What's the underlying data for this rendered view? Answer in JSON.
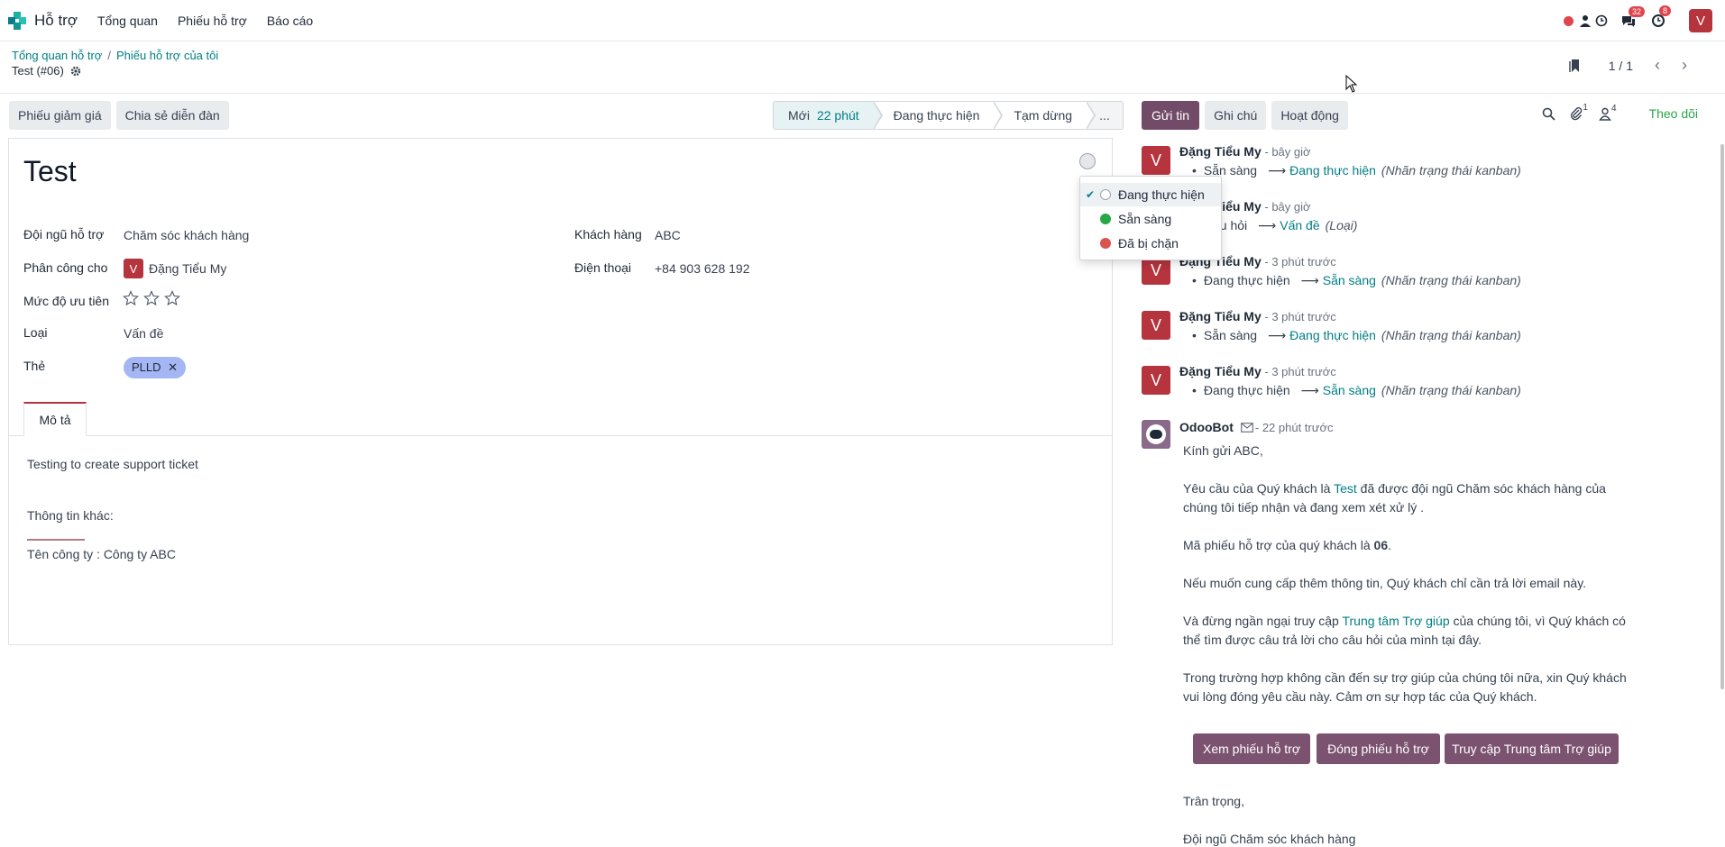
{
  "navbar": {
    "app_name": "Hỗ trợ",
    "menu": [
      "Tổng quan",
      "Phiếu hỗ trợ",
      "Báo cáo"
    ],
    "messages_count": "32",
    "activities_count": "8",
    "user_initial": "V"
  },
  "breadcrumb": {
    "items": [
      "Tổng quan hỗ trợ",
      "Phiếu hỗ trợ của tôi"
    ],
    "current": "Test (#06)"
  },
  "pager": {
    "value": "1 / 1"
  },
  "actions": {
    "coupon": "Phiếu giảm giá",
    "share_forum": "Chia sẻ diễn đàn"
  },
  "stages": [
    {
      "label": "Mới",
      "duration": "22 phút"
    },
    {
      "label": "Đang thực hiện"
    },
    {
      "label": "Tạm dừng"
    },
    {
      "label": "..."
    }
  ],
  "form": {
    "title": "Test",
    "team_label": "Đội ngũ hỗ trợ",
    "team_value": "Chăm sóc khách hàng",
    "assign_label": "Phân công cho",
    "assign_initial": "V",
    "assign_value": "Đặng Tiểu My",
    "priority_label": "Mức độ ưu tiên",
    "type_label": "Loại",
    "type_value": "Vấn đề",
    "tags_label": "Thẻ",
    "tag_value": "PLLD",
    "customer_label": "Khách hàng",
    "customer_value": "ABC",
    "phone_label": "Điện thoại",
    "phone_value": "+84 903 628 192",
    "tab_description": "Mô tả",
    "desc_line1": "Testing to create support ticket",
    "desc_line2": "Thông tin khác:",
    "desc_line3": "Tên công ty : Công ty ABC"
  },
  "kanban_dropdown": {
    "items": [
      {
        "label": "Đang thực hiện",
        "color": "#ffffff"
      },
      {
        "label": "Sẵn sàng",
        "color": "#28a745"
      },
      {
        "label": "Đã bị chặn",
        "color": "#d9534f"
      }
    ]
  },
  "chatter": {
    "send_message": "Gửi tin",
    "log_note": "Ghi chú",
    "activities": "Hoạt động",
    "attachments_count": "1",
    "followers_count": "4",
    "follow": "Theo dõi",
    "messages": [
      {
        "initial": "V",
        "author": "Đặng Tiểu My",
        "when": " - bây giờ",
        "from": "Sẵn sàng",
        "to": "Đang thực hiện",
        "field": "(Nhãn trạng thái kanban)"
      },
      {
        "initial": "V",
        "author": "Đặng Tiểu My",
        "when": " - bây giờ",
        "from": "Câu hỏi",
        "to": "Vấn đề",
        "field": "(Loại)"
      },
      {
        "initial": "V",
        "author": "Đặng Tiểu My",
        "when": " - 3 phút trước",
        "from": "Đang thực hiện",
        "to": "Sẵn sàng",
        "field": "(Nhãn trạng thái kanban)"
      },
      {
        "initial": "V",
        "author": "Đặng Tiểu My",
        "when": " - 3 phút trước",
        "from": "Sẵn sàng",
        "to": "Đang thực hiện",
        "field": "(Nhãn trạng thái kanban)"
      },
      {
        "initial": "V",
        "author": "Đặng Tiểu My",
        "when": " - 3 phút trước",
        "from": "Đang thực hiện",
        "to": "Sẵn sàng",
        "field": "(Nhãn trạng thái kanban)"
      }
    ],
    "bot": {
      "author": "OdooBot",
      "when": " - 22 phút trước",
      "greeting": "Kính gửi ABC,",
      "p1_a": "Yêu cầu của Quý khách là ",
      "p1_link": "Test",
      "p1_b": " đã được đội ngũ Chăm sóc khách hàng của chúng tôi tiếp nhận và đang xem xét xử lý .",
      "p2_a": "Mã phiếu hỗ trợ của quý khách là ",
      "p2_b": "06",
      "p2_c": ".",
      "p3": "Nếu muốn cung cấp thêm thông tin, Quý khách chỉ cần trả lời email này.",
      "p4_a": "Và đừng ngần ngại truy cập ",
      "p4_link": "Trung tâm Trợ giúp",
      "p4_b": " của chúng tôi, vì Quý khách có thể tìm được câu trả lời cho câu hỏi của mình tại đây.",
      "p5": "Trong trường hợp không cần đến sự trợ giúp của chúng tôi nữa, xin Quý khách vui lòng đóng yêu cầu này. Cảm ơn sự hợp tác của Quý khách.",
      "btn_view": "Xem phiếu hỗ trợ",
      "btn_close": "Đóng phiếu hỗ trợ",
      "btn_help": "Truy cập Trung tâm Trợ giúp",
      "closing": "Trân trọng,",
      "signature": "Đội ngũ Chăm sóc khách hàng"
    }
  }
}
